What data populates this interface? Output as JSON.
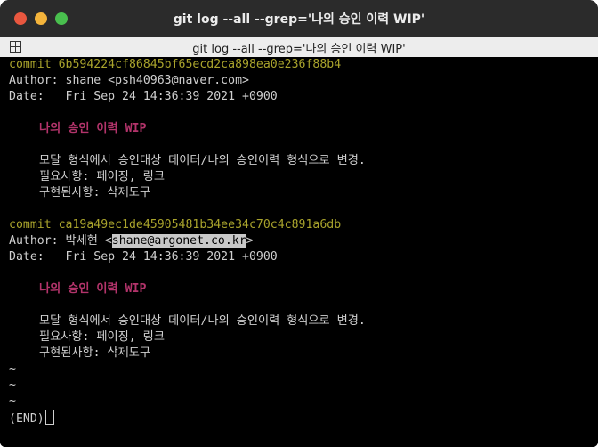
{
  "window": {
    "title": "git log --all --grep='나의 승인 이력 WIP'",
    "tab_title": "git log --all --grep='나의 승인 이력 WIP'"
  },
  "log": [
    {
      "commit": "commit 6b594224cf86845bf65ecd2ca898ea0e236f88b4",
      "author_prefix": "Author: shane <psh40963@naver.com>",
      "author_email": "",
      "author_suffix": "",
      "date": "Date:   Fri Sep 24 14:36:39 2021 +0900",
      "subject": "나의 승인 이력 WIP",
      "body": [
        "모달 형식에서 승인대상 데이터/나의 승인이력 형식으로 변경.",
        "필요사항: 페이징, 링크",
        "구현된사항: 삭제도구"
      ]
    },
    {
      "commit": "commit ca19a49ec1de45905481b34ee34c70c4c891a6db",
      "author_prefix": "Author: 박세현 <",
      "author_email": "shane@argonet.co.kr",
      "author_suffix": ">",
      "date": "Date:   Fri Sep 24 14:36:39 2021 +0900",
      "subject": "나의 승인 이력 WIP",
      "body": [
        "모달 형식에서 승인대상 데이터/나의 승인이력 형식으로 변경.",
        "필요사항: 페이징, 링크",
        "구현된사항: 삭제도구"
      ]
    }
  ],
  "tildes": [
    "~",
    "~",
    "~"
  ],
  "pager_end": "(END)"
}
